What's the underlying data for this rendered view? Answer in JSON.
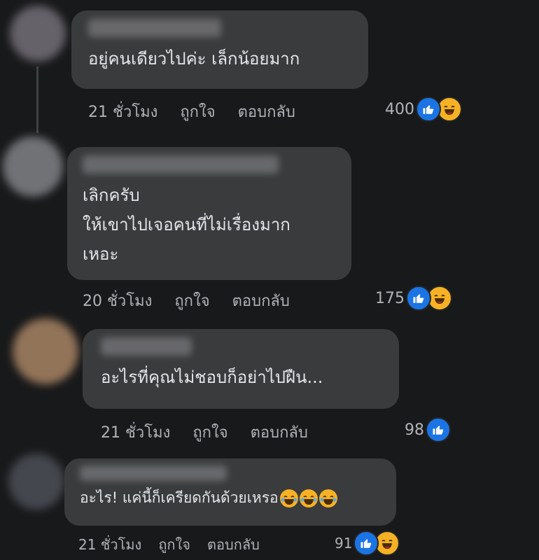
{
  "comments": [
    {
      "text_lines": [
        "อยู่คนเดียวไปค่ะ เล็กน้อยมาก"
      ],
      "time": "21 ชั่วโมง",
      "like_label": "ถูกใจ",
      "reply_label": "ตอบกลับ",
      "reaction_count": "400",
      "reactions": [
        "like-icon",
        "haha-icon"
      ]
    },
    {
      "text_lines": [
        "เลิกครับ",
        "ให้เขาไปเจอคนที่ไม่เรื่องมาก",
        "เหอะ"
      ],
      "time": "20 ชั่วโมง",
      "like_label": "ถูกใจ",
      "reply_label": "ตอบกลับ",
      "reaction_count": "175",
      "reactions": [
        "like-icon",
        "haha-icon"
      ]
    },
    {
      "text_lines": [
        "อะไรที่คุณไม่ชอบก็อย่าไปฝืน..."
      ],
      "time": "21 ชั่วโมง",
      "like_label": "ถูกใจ",
      "reply_label": "ตอบกลับ",
      "reaction_count": "98",
      "reactions": [
        "like-icon"
      ]
    },
    {
      "text_lines": [
        "อะไร! แค่นี้ก็เครียดกันด้วยเหรอ"
      ],
      "inline_emojis": [
        "haha-tears-icon",
        "haha-tears-icon",
        "haha-tears-icon"
      ],
      "time": "21 ชั่วโมง",
      "like_label": "ถูกใจ",
      "reply_label": "ตอบกลับ",
      "reaction_count": "91",
      "reactions": [
        "like-icon",
        "haha-icon"
      ]
    }
  ],
  "colors": {
    "background": "#18191a",
    "bubble": "#3a3b3c",
    "text": "#e4e6eb",
    "secondary_text": "#b0b3b8",
    "like_blue": "#1b74e4",
    "haha_yellow": "#f7b125"
  }
}
